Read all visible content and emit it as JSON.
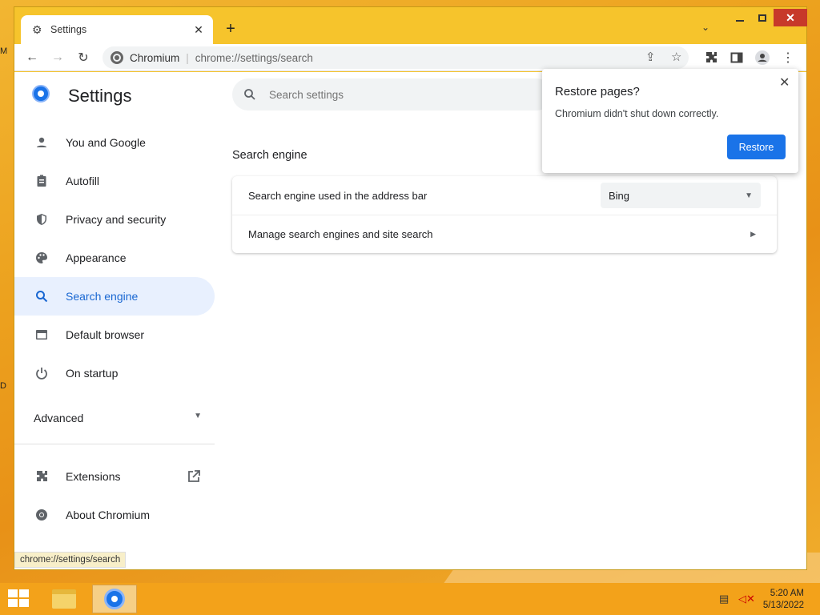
{
  "desktop": {
    "labels": [
      "M",
      "D"
    ]
  },
  "browser": {
    "tab": {
      "title": "Settings",
      "close": "✕"
    },
    "new_tab": "+",
    "tab_search": "⌄",
    "window_controls": {
      "minimize": "",
      "maximize": "",
      "close": "✕"
    },
    "toolbar": {
      "back": "←",
      "forward": "→",
      "reload": "↻",
      "site_name": "Chromium",
      "url": "chrome://settings/search",
      "share_icon": "share-icon",
      "star_icon": "☆",
      "extensions_icon": "puzzle-icon",
      "sidepanel_icon": "sidepanel-icon",
      "profile_icon": "profile-icon",
      "menu": "⋮"
    }
  },
  "settings": {
    "title": "Settings",
    "search_placeholder": "Search settings",
    "nav": [
      {
        "label": "You and Google",
        "icon": "person-icon"
      },
      {
        "label": "Autofill",
        "icon": "clipboard-icon"
      },
      {
        "label": "Privacy and security",
        "icon": "shield-icon"
      },
      {
        "label": "Appearance",
        "icon": "palette-icon"
      },
      {
        "label": "Search engine",
        "icon": "search-icon",
        "active": true
      },
      {
        "label": "Default browser",
        "icon": "browser-icon"
      },
      {
        "label": "On startup",
        "icon": "power-icon"
      }
    ],
    "advanced": "Advanced",
    "nav_bottom": [
      {
        "label": "Extensions",
        "icon": "puzzle-icon"
      },
      {
        "label": "About Chromium",
        "icon": "chromium-icon"
      }
    ],
    "section_title": "Search engine",
    "rows": {
      "address_bar_label": "Search engine used in the address bar",
      "engine_value": "Bing",
      "manage_label": "Manage search engines and site search"
    }
  },
  "popup": {
    "title": "Restore pages?",
    "message": "Chromium didn't shut down correctly.",
    "button": "Restore",
    "close": "✕"
  },
  "status_url": "chrome://settings/search",
  "taskbar": {
    "time": "5:20 AM",
    "date": "5/13/2022"
  },
  "colors": {
    "accent": "#1a73e8",
    "active_nav_bg": "#e8f0fe",
    "taskbar": "#f3a21a"
  }
}
